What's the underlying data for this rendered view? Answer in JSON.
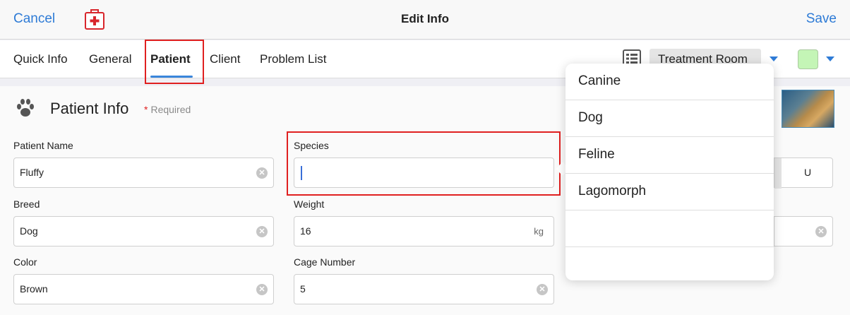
{
  "header": {
    "cancel_label": "Cancel",
    "title": "Edit Info",
    "save_label": "Save"
  },
  "tabs": [
    {
      "label": "Quick Info",
      "active": false
    },
    {
      "label": "General",
      "active": false
    },
    {
      "label": "Patient",
      "active": true
    },
    {
      "label": "Client",
      "active": false
    },
    {
      "label": "Problem List",
      "active": false
    }
  ],
  "toolbar": {
    "room_select": "Treatment Room",
    "status_color": "#c4f5b6"
  },
  "section": {
    "title": "Patient Info",
    "required_star": "*",
    "required_label": "Required"
  },
  "fields": {
    "patient_name": {
      "label": "Patient Name",
      "value": "Fluffy"
    },
    "species": {
      "label": "Species",
      "value": ""
    },
    "breed": {
      "label": "Breed",
      "value": "Dog"
    },
    "weight": {
      "label": "Weight",
      "value": "16",
      "unit": "kg"
    },
    "color": {
      "label": "Color",
      "value": "Brown"
    },
    "cage_number": {
      "label": "Cage Number",
      "value": "5"
    }
  },
  "sex_segment": {
    "visible_option": "U"
  },
  "species_options": [
    "Canine",
    "Dog",
    "Feline",
    "Lagomorph",
    "",
    ""
  ],
  "colors": {
    "accent": "#2e7bd6",
    "highlight": "#e02020"
  }
}
